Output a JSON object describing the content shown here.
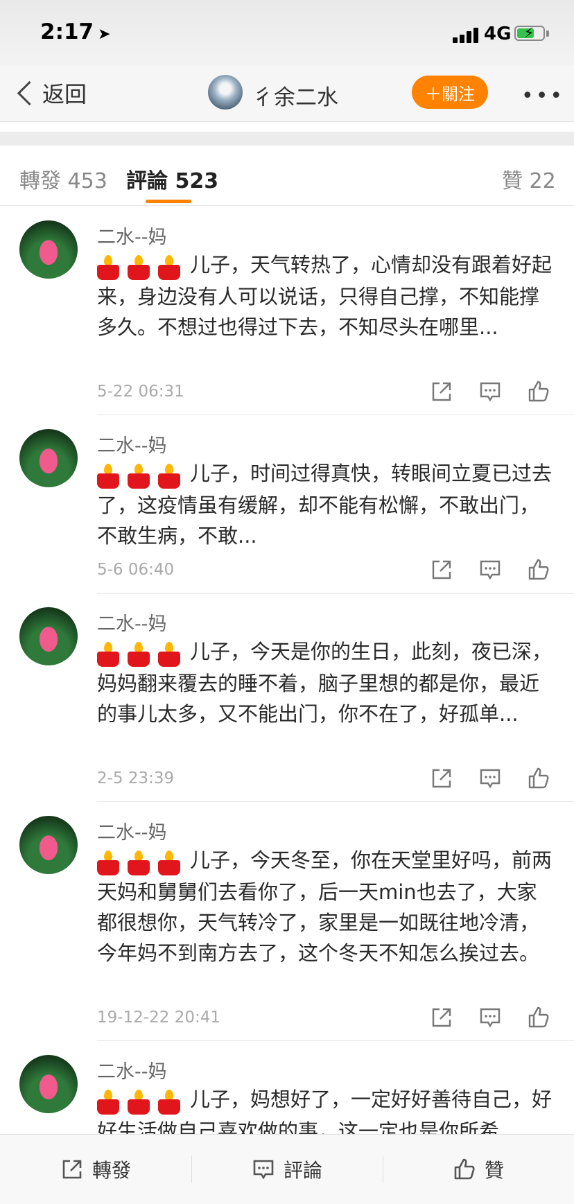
{
  "status_bar": {
    "time": "2:17",
    "network": "4G"
  },
  "nav": {
    "back_label": "返回",
    "user_name": "彳余二水",
    "follow_label": "＋關注",
    "more_label": "•••"
  },
  "tabs": {
    "reposts": "轉發 453",
    "comments": "評論 523",
    "likes": "贊 22"
  },
  "comments": [
    {
      "author": "二水--妈",
      "text": "儿子，天气转热了，心情却没有跟着好起来，身边没有人可以说话，只得自己撑，不知能撑多久。不想过也得过下去，不知尽头在哪里...",
      "time": "5-22 06:31"
    },
    {
      "author": "二水--妈",
      "text": "儿子，时间过得真快，转眼间立夏已过去了，这疫情虽有缓解，却不能有松懈，不敢出门，不敢生病，不敢...",
      "time": "5-6 06:40"
    },
    {
      "author": "二水--妈",
      "text": "儿子，今天是你的生日，此刻，夜已深，妈妈翻来覆去的睡不着，脑子里想的都是你，最近的事儿太多，又不能出门，你不在了，好孤单...",
      "time": "2-5 23:39"
    },
    {
      "author": "二水--妈",
      "text": "儿子，今天冬至，你在天堂里好吗，前两天妈和舅舅们去看你了，后一天min也去了，大家都很想你，天气转冷了，家里是一如既往地冷清，今年妈不到南方去了，这个冬天不知怎么挨过去。",
      "time": "19-12-22 20:41"
    },
    {
      "author": "二水--妈",
      "text": "儿子，妈想好了，一定好好善待自己，好好生活做自己喜欢做的事，这一定也是你所希",
      "time": ""
    }
  ],
  "toolbar": {
    "repost": "轉發",
    "comment": "評論",
    "like": "贊"
  },
  "colors": {
    "accent": "#ff8200",
    "candle": "#e0161c"
  },
  "icons": [
    "location-arrow-icon",
    "signal-icon",
    "battery-icon",
    "back-chevron-icon",
    "share-icon",
    "comment-icon",
    "like-icon",
    "candle-icon"
  ]
}
